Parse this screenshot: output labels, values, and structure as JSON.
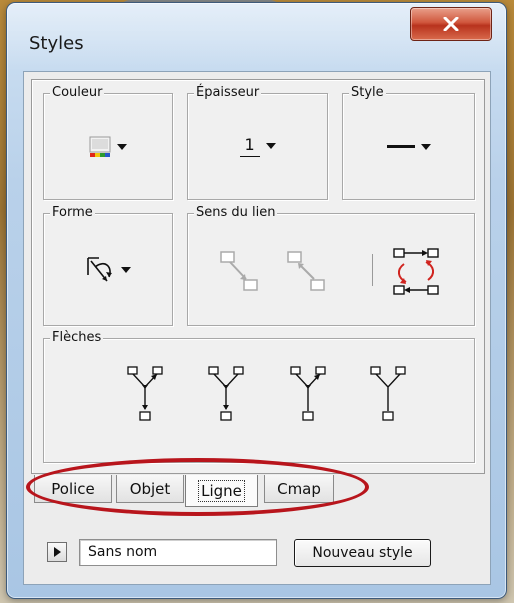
{
  "window": {
    "title": "Styles",
    "close_glyph": "x"
  },
  "groups": {
    "couleur": {
      "label": "Couleur",
      "icon": "color-swatch-icon"
    },
    "epaisseur": {
      "label": "Épaisseur",
      "value": "1"
    },
    "style": {
      "label": "Style",
      "icon": "line-style-icon"
    },
    "forme": {
      "label": "Forme",
      "icon": "connector-shape-icon"
    },
    "sens": {
      "label": "Sens du lien",
      "icons": [
        "link-direction-down-icon",
        "link-direction-up-icon",
        "link-swap-direction-icon"
      ]
    },
    "fleches": {
      "label": "Flèches",
      "icons": [
        "arrows-both-icon",
        "arrows-bottom-icon",
        "arrows-top-icon",
        "arrows-none-icon"
      ]
    }
  },
  "tabs": [
    {
      "label": "Police",
      "active": false
    },
    {
      "label": "Objet",
      "active": false
    },
    {
      "label": "Ligne",
      "active": true
    },
    {
      "label": "Cmap",
      "active": false
    }
  ],
  "footer": {
    "style_name_value": "Sans nom",
    "new_style_label": "Nouveau style"
  },
  "colors": {
    "annotation_ellipse": "#b8151c",
    "close_button": "#c9442a",
    "swap_arrows": "#d0241f"
  }
}
